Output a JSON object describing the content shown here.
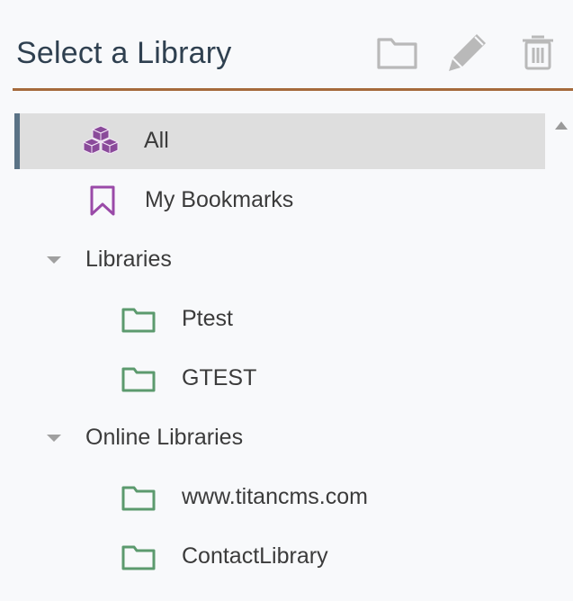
{
  "header": {
    "title": "Select a Library",
    "toolbar": {
      "new_folder_icon": "folder-outline-icon",
      "edit_icon": "pencil-icon",
      "delete_icon": "trash-icon"
    }
  },
  "colors": {
    "accent_divider": "#a56a3c",
    "selected_bg": "#dedede",
    "selected_bar": "#5b7386",
    "purple_icon": "#8a4a9a",
    "folder_green": "#5c9a6e",
    "toolbar_icon": "#b9b9b9"
  },
  "tree": {
    "items": [
      {
        "label": "All",
        "icon": "cubes-icon",
        "selected": true
      },
      {
        "label": "My Bookmarks",
        "icon": "bookmark-icon"
      },
      {
        "label": "Libraries",
        "expandable": true,
        "expanded": true,
        "children": [
          {
            "label": "Ptest",
            "icon": "folder-icon"
          },
          {
            "label": "GTEST",
            "icon": "folder-icon"
          }
        ]
      },
      {
        "label": "Online Libraries",
        "expandable": true,
        "expanded": true,
        "children": [
          {
            "label": "www.titancms.com",
            "icon": "folder-icon"
          },
          {
            "label": "ContactLibrary",
            "icon": "folder-icon"
          }
        ]
      }
    ]
  }
}
